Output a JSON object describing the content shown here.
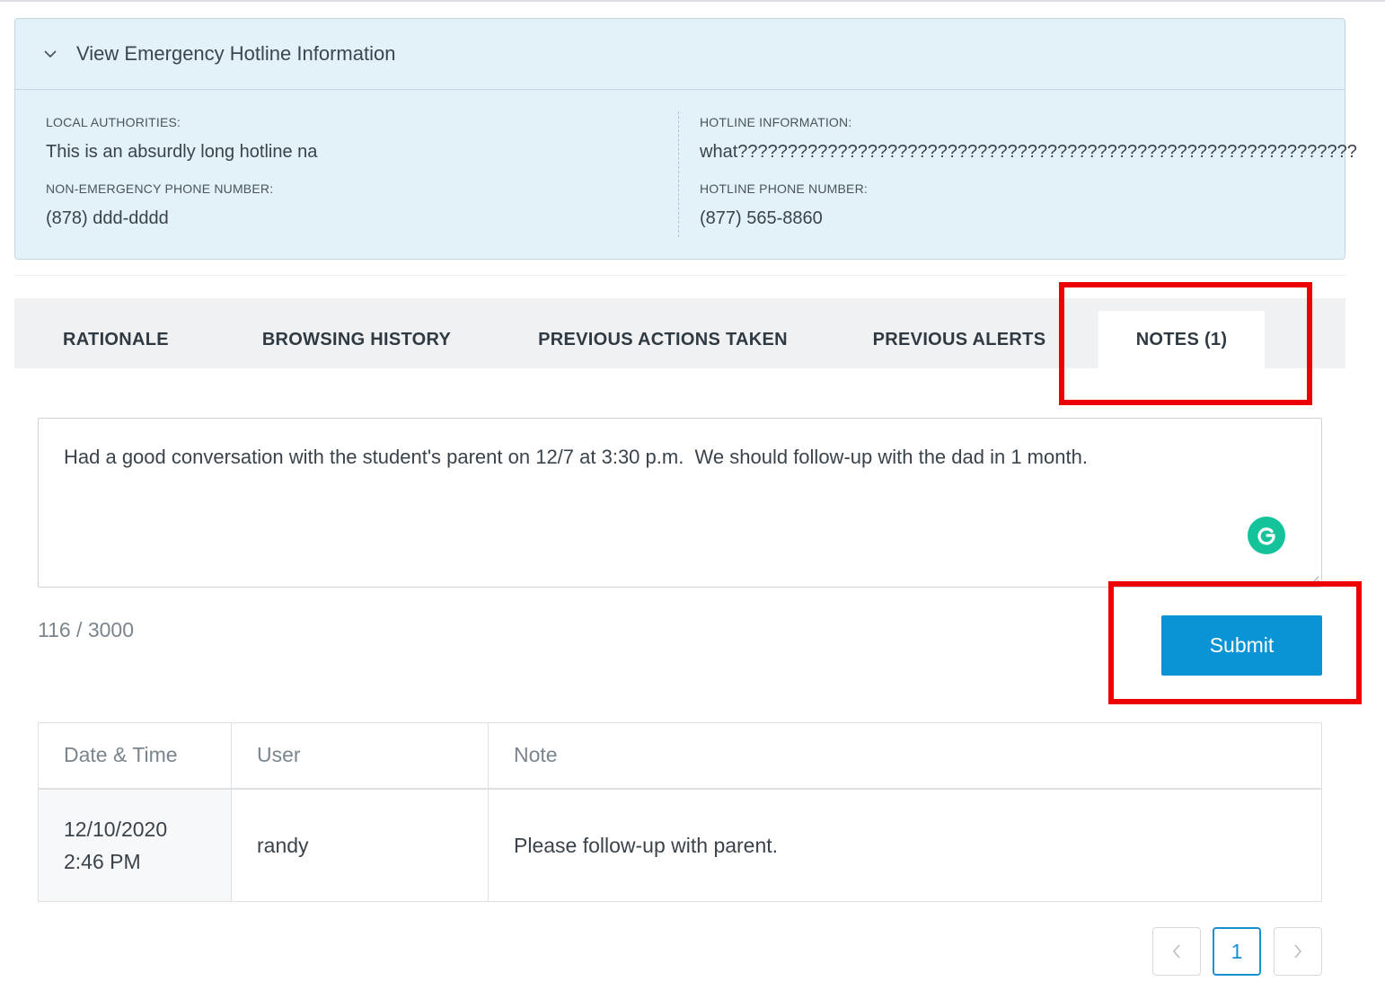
{
  "hotline": {
    "title": "View Emergency Hotline Information",
    "local_authorities_label": "LOCAL AUTHORITIES:",
    "local_authorities_value": "This is an absurdly long hotline na",
    "non_emergency_label": "NON-EMERGENCY PHONE NUMBER:",
    "non_emergency_value": "(878) ddd-dddd",
    "hotline_info_label": "HOTLINE INFORMATION:",
    "hotline_info_value": "what??????????????????????????????????????????????????????????????",
    "hotline_phone_label": "HOTLINE PHONE NUMBER:",
    "hotline_phone_value": "(877) 565-8860"
  },
  "tabs": [
    {
      "label": "RATIONALE"
    },
    {
      "label": "BROWSING HISTORY"
    },
    {
      "label": "PREVIOUS ACTIONS TAKEN"
    },
    {
      "label": "PREVIOUS ALERTS"
    },
    {
      "label": "NOTES (1)"
    }
  ],
  "active_tab": "NOTES (1)",
  "note": {
    "text": "Had a good conversation with the student's parent on 12/7 at 3:30 p.m.  We should follow-up with the dad in 1 month.",
    "counter": "116 / 3000",
    "submit_label": "Submit"
  },
  "table": {
    "headers": [
      "Date & Time",
      "User",
      "Note"
    ],
    "rows": [
      {
        "date": "12/10/2020",
        "time": "2:46 PM",
        "user": "randy",
        "note": "Please follow-up with parent."
      }
    ]
  },
  "pagination": {
    "current": "1",
    "prev_icon": "chevron-left-icon",
    "next_icon": "chevron-right-icon"
  },
  "colors": {
    "accent": "#0a93d5",
    "highlight": "#ec0000",
    "panel_bg": "#e3f1f9",
    "grammarly": "#15c39a"
  }
}
